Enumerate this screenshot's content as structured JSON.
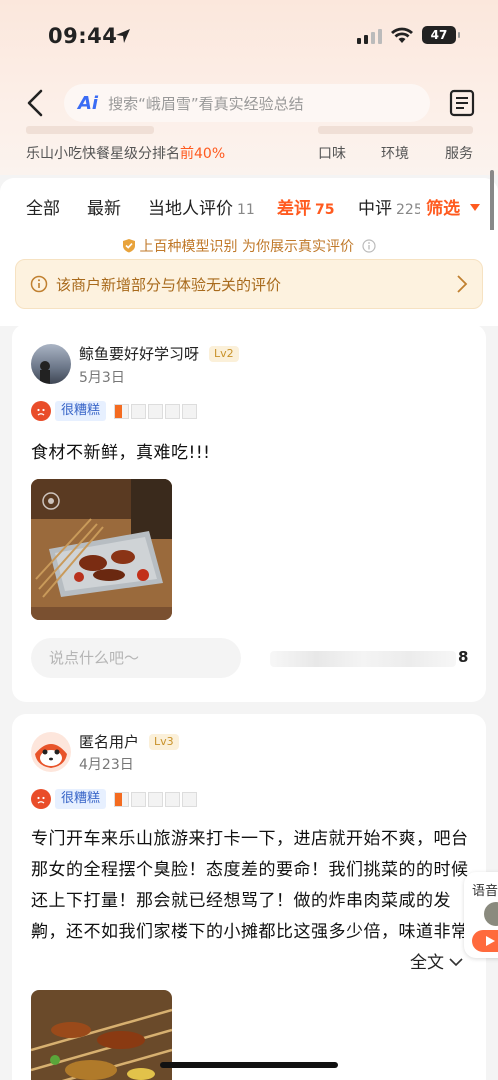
{
  "status_bar": {
    "time": "09:44",
    "battery": "47"
  },
  "search": {
    "ai_label": "Ai",
    "placeholder": "搜索“峨眉雪”看真实经验总结"
  },
  "shop_summary": {
    "rank_prefix": "乐山小吃快餐星级分排名",
    "rank_value": "前40%",
    "score_labels": [
      "口味",
      "环境",
      "服务"
    ]
  },
  "tabs": [
    {
      "label": "全部",
      "count": ""
    },
    {
      "label": "最新",
      "count": ""
    },
    {
      "label": "当地人评价",
      "count": "11"
    },
    {
      "label": "差评",
      "count": "75"
    },
    {
      "label": "中评",
      "count": "225"
    }
  ],
  "filter_label": "筛选",
  "model_note": "上百种模型识别 为你展示真实评价",
  "alert_text": "该商户新增部分与体验无关的评价",
  "reviews": [
    {
      "user": "鲸鱼要好好学习呀",
      "level": "Lv2",
      "date": "5月3日",
      "rating_label": "很糟糕",
      "rating": 0.5,
      "text": "食材不新鲜，真难吃!!!",
      "comment_placeholder": "说点什么吧～",
      "likes": "8"
    },
    {
      "user": "匿名用户",
      "level": "Lv3",
      "date": "4月23日",
      "rating_label": "很糟糕",
      "rating": 0.5,
      "text": "专门开车来乐山旅游来打卡一下，进店就开始不爽，吧台那女的全程摆个臭脸！态度差的要命！我们挑菜的的时候还上下打量！那会就已经想骂了！做的炸串肉菜咸的发齁，还不如我们家楼下的小摊都比这强多少倍，味道非常的垃圾！炸的油有点味，平…",
      "more_label": "全文"
    }
  ],
  "floating_voice": {
    "label": "语音"
  },
  "colors": {
    "accent": "#ff5a1f",
    "header_bg": "#fbe7dc"
  }
}
